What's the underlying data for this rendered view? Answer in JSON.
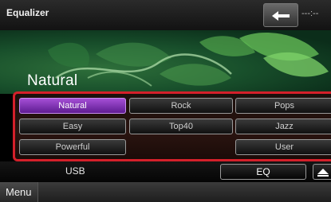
{
  "header": {
    "title": "Equalizer",
    "status_text": "---:--"
  },
  "display": {
    "preset_name": "Natural"
  },
  "presets": {
    "natural": "Natural",
    "rock": "Rock",
    "pops": "Pops",
    "easy": "Easy",
    "top40": "Top40",
    "jazz": "Jazz",
    "powerful": "Powerful",
    "user": "User",
    "selected": "Natural"
  },
  "bottom": {
    "source_label": "USB",
    "eq_label": "EQ"
  },
  "menu": {
    "label": "Menu"
  },
  "colors": {
    "highlight": "#d4202a",
    "selected_button": "#8a3fc0"
  }
}
